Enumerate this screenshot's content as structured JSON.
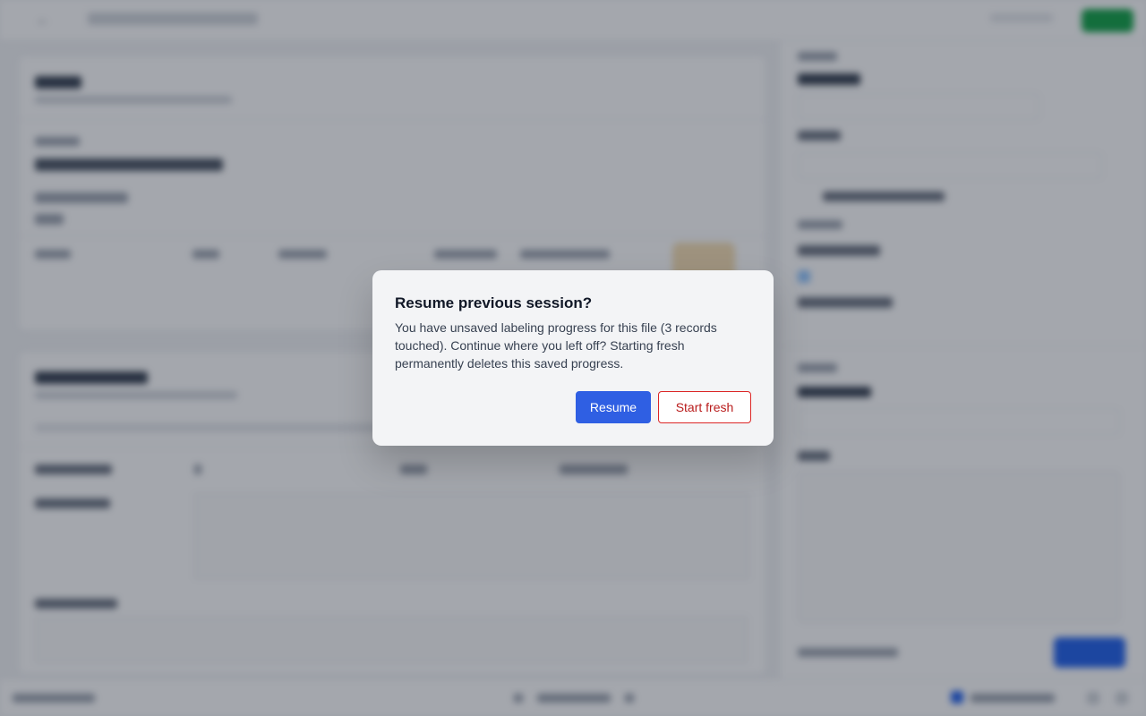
{
  "dialog": {
    "title": "Resume previous session?",
    "message": "You have unsaved labeling progress for this file (3 records touched). Continue where you left off? Starting fresh permanently deletes this saved progress.",
    "resume_label": "Resume",
    "start_fresh_label": "Start fresh"
  },
  "colors": {
    "primary": "#2f5fe3",
    "danger": "#b91c1c",
    "success": "#16a34a",
    "overlay": "rgba(17,24,39,0.38)"
  },
  "icons": {
    "back": "back-arrow-icon"
  }
}
